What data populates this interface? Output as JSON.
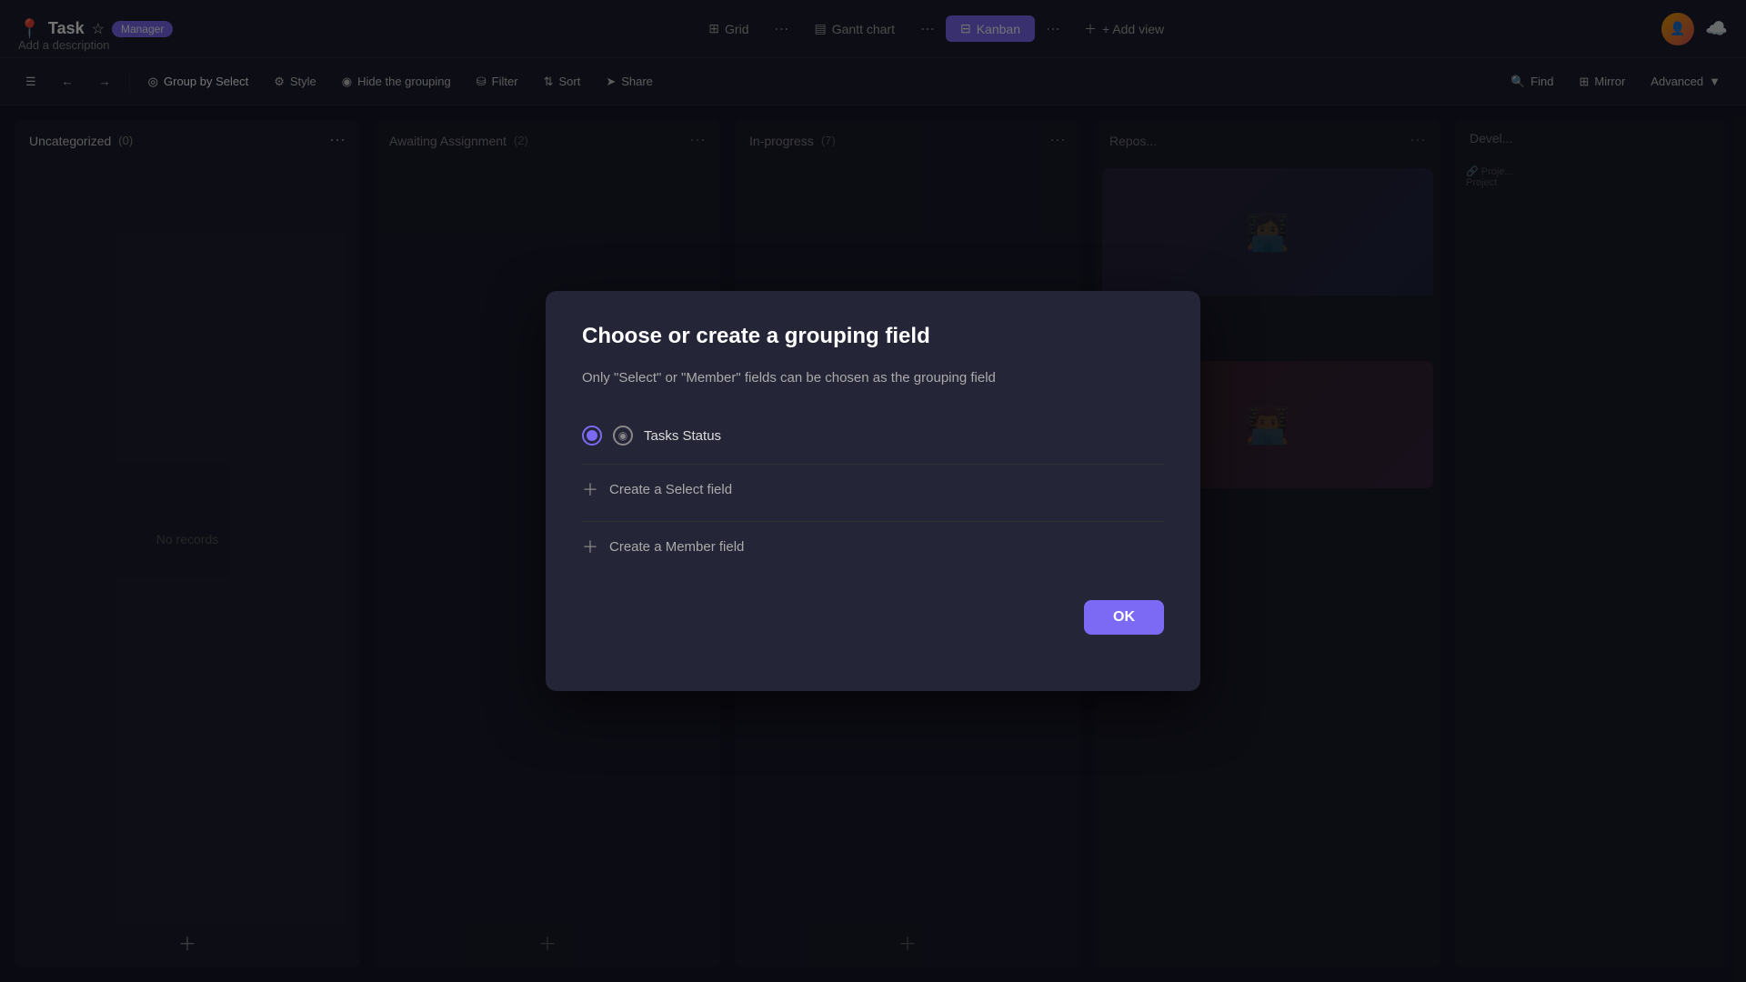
{
  "app": {
    "title": "Task",
    "badge": "Manager",
    "description": "Add a description",
    "star_icon": "⭐"
  },
  "top_tabs": [
    {
      "id": "grid",
      "label": "Grid",
      "icon": "⊞",
      "active": false
    },
    {
      "id": "gantt",
      "label": "Gantt chart",
      "icon": "▤",
      "active": false
    },
    {
      "id": "kanban",
      "label": "Kanban",
      "icon": "⊟",
      "active": true
    }
  ],
  "add_view_label": "+ Add view",
  "toolbar": {
    "menu_icon": "☰",
    "undo_icon": "←",
    "redo_icon": "→",
    "group_by_label": "Group by Select",
    "style_label": "Style",
    "hide_grouping_label": "Hide the grouping",
    "filter_label": "Filter",
    "sort_label": "Sort",
    "share_label": "Share",
    "find_label": "Find",
    "mirror_label": "Mirror",
    "advanced_label": "Advanced"
  },
  "columns": [
    {
      "id": "uncategorized",
      "title": "Uncategorized",
      "count": 0,
      "no_records": "No records"
    },
    {
      "id": "awaiting",
      "title": "Awaiting Assignment",
      "count": 2
    },
    {
      "id": "in_progress",
      "title": "In-progress",
      "count": 7
    }
  ],
  "modal": {
    "title": "Choose or create a grouping field",
    "description": "Only \"Select\" or \"Member\" fields can be chosen as the grouping field",
    "options": [
      {
        "id": "tasks_status",
        "label": "Tasks Status",
        "selected": true
      }
    ],
    "create_options": [
      {
        "id": "create_select",
        "label": "Create a Select field"
      },
      {
        "id": "create_member",
        "label": "Create a Member field"
      }
    ],
    "ok_label": "OK"
  }
}
